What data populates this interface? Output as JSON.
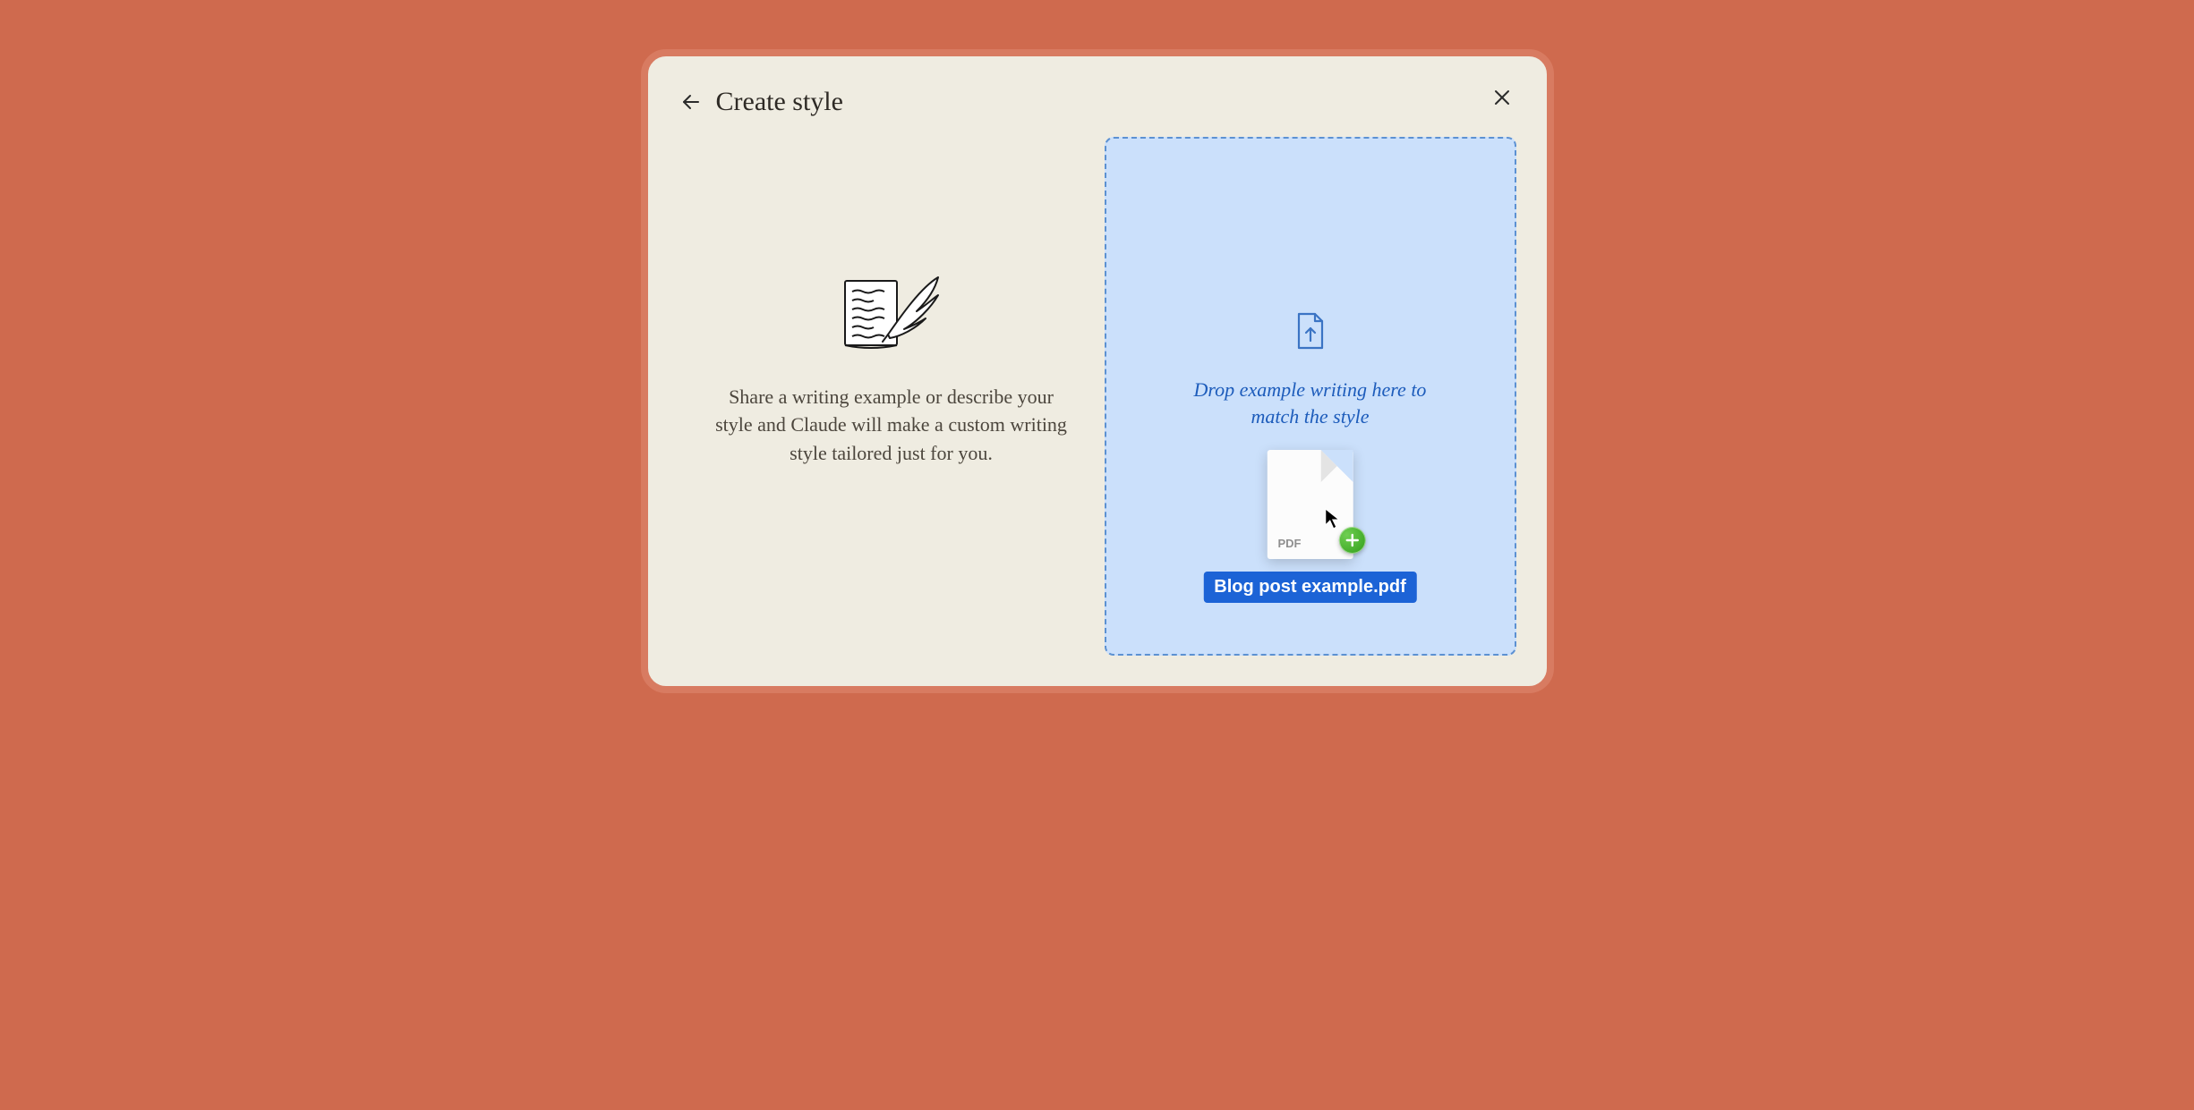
{
  "modal": {
    "title": "Create style",
    "description": "Share a writing example or describe your style and Claude will make a custom writing style tailored just for you.",
    "dropzone_text": "Drop example writing here to match the style"
  },
  "dragged_file": {
    "type_label": "PDF",
    "filename": "Blog post example.pdf"
  },
  "icons": {
    "back": "arrow-left-icon",
    "close": "x-icon",
    "upload": "file-upload-icon",
    "plus": "plus-icon",
    "quill": "quill-paper-icon",
    "cursor": "cursor-icon"
  }
}
